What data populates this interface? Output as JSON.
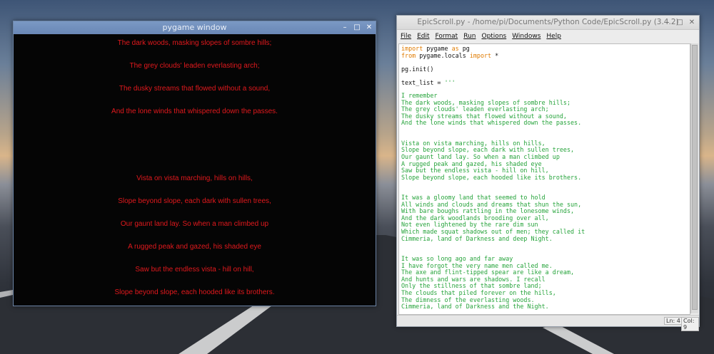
{
  "pygame_window": {
    "title": "pygame window",
    "controls": {
      "minimize": "–",
      "maximize": "□",
      "close": "✕"
    },
    "lines": [
      "The dark woods, masking slopes of sombre hills;",
      "The grey clouds' leaden everlasting arch;",
      "The dusky streams that flowed without a sound,",
      "And the lone winds that whispered down the passes.",
      "Vista on vista marching, hills on hills,",
      "Slope beyond slope, each dark with sullen trees,",
      "Our gaunt land lay. So when a man climbed up",
      "A rugged peak and gazed, his shaded eye",
      "Saw but the endless vista - hill on hill,",
      "Slope beyond slope, each hooded like its brothers."
    ],
    "text_color": "#e1191d"
  },
  "editor_window": {
    "title": "EpicScroll.py - /home/pi/Documents/Python Code/EpicScroll.py (3.4.2)",
    "controls": {
      "minimize": "–",
      "maximize": "□",
      "close": "✕"
    },
    "menu": [
      "File",
      "Edit",
      "Format",
      "Run",
      "Options",
      "Windows",
      "Help"
    ],
    "code": {
      "l1_kw": "import",
      "l1_rest": " pygame ",
      "l1_kw2": "as",
      "l1_rest2": " pg",
      "l2_kw": "from",
      "l2_rest": " pygame.locals ",
      "l2_kw2": "import",
      "l2_rest2": " *",
      "l3": "pg.init()",
      "l4_a": "text_list = ",
      "l4_b": "'''",
      "text_lines": [
        "I remember",
        "The dark woods, masking slopes of sombre hills;",
        "The grey clouds' leaden everlasting arch;",
        "The dusky streams that flowed without a sound,",
        "And the lone winds that whispered down the passes.",
        "",
        "",
        "Vista on vista marching, hills on hills,",
        "Slope beyond slope, each dark with sullen trees,",
        "Our gaunt land lay. So when a man climbed up",
        "A rugged peak and gazed, his shaded eye",
        "Saw but the endless vista - hill on hill,",
        "Slope beyond slope, each hooded like its brothers.",
        "",
        "",
        "It was a gloomy land that seemed to hold",
        "All winds and clouds and dreams that shun the sun,",
        "With bare boughs rattling in the lonesome winds,",
        "And the dark woodlands brooding over all,",
        "Not even lightened by the rare dim sun",
        "Which made squat shadows out of men; they called it",
        "Cimmeria, land of Darkness and deep Night.",
        "",
        "",
        "It was so long ago and far away",
        "I have forgot the very name men called me.",
        "The axe and flint-tipped spear are like a dream,",
        "And hunts and wars are shadows. I recall",
        "Only the stillness of that sombre land;",
        "The clouds that piled forever on the hills,",
        "The dimness of the everlasting woods.",
        "Cimmeria, land of Darkness and the Night."
      ]
    },
    "status": {
      "line": "Ln: 4",
      "col": "Col: 9"
    },
    "colors": {
      "keyword": "#e07b00",
      "string": "#25a33a",
      "plain": "#111111"
    }
  }
}
